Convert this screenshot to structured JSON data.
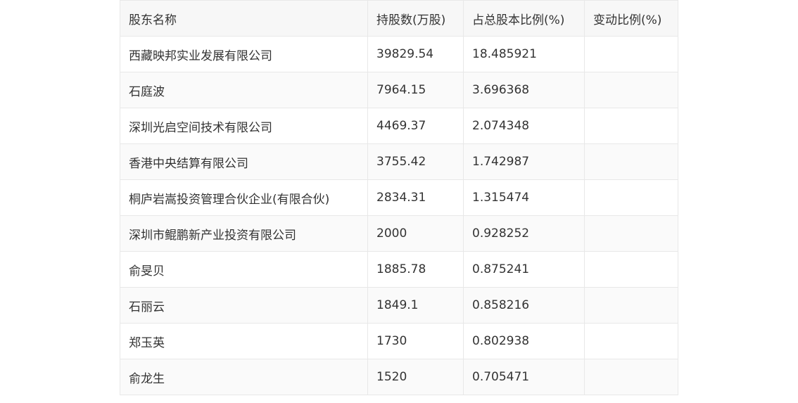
{
  "table": {
    "headers": [
      "股东名称",
      "持股数(万股)",
      "占总股本比例(%)",
      "变动比例(%)"
    ],
    "rows": [
      [
        "西藏映邦实业发展有限公司",
        "39829.54",
        "18.485921",
        ""
      ],
      [
        "石庭波",
        "7964.15",
        "3.696368",
        ""
      ],
      [
        "深圳光启空间技术有限公司",
        "4469.37",
        "2.074348",
        ""
      ],
      [
        "香港中央结算有限公司",
        "3755.42",
        "1.742987",
        ""
      ],
      [
        "桐庐岩嵩投资管理合伙企业(有限合伙)",
        "2834.31",
        "1.315474",
        ""
      ],
      [
        "深圳市鲲鹏新产业投资有限公司",
        "2000",
        "0.928252",
        ""
      ],
      [
        "俞旻贝",
        "1885.78",
        "0.875241",
        ""
      ],
      [
        "石丽云",
        "1849.1",
        "0.858216",
        ""
      ],
      [
        "郑玉英",
        "1730",
        "0.802938",
        ""
      ],
      [
        "俞龙生",
        "1520",
        "0.705471",
        ""
      ]
    ]
  }
}
